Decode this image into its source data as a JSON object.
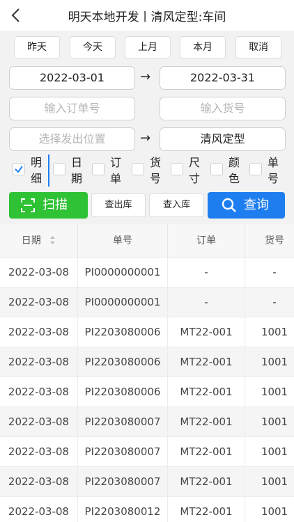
{
  "header": {
    "title": "明天本地开发丨清风定型:车间"
  },
  "quick_filters": [
    "昨天",
    "今天",
    "上月",
    "本月",
    "取消"
  ],
  "date_range": {
    "start": "2022-03-01",
    "arrow": "→",
    "end": "2022-03-31"
  },
  "inputs": {
    "order_placeholder": "输入订单号",
    "goods_placeholder": "输入货号"
  },
  "location": {
    "placeholder": "选择发出位置",
    "arrow": "→",
    "target": "清风定型"
  },
  "checkboxes": [
    {
      "label": "明细",
      "checked": true
    },
    {
      "label": "日期",
      "checked": false
    },
    {
      "label": "订单",
      "checked": false
    },
    {
      "label": "货号",
      "checked": false
    },
    {
      "label": "尺寸",
      "checked": false
    },
    {
      "label": "颜色",
      "checked": false
    },
    {
      "label": "单号",
      "checked": false
    }
  ],
  "actions": {
    "scan": "扫描",
    "outbound": "查出库",
    "inbound": "查入库",
    "query": "查询"
  },
  "colors": {
    "scan": "#2ec234",
    "query": "#1e7ef0",
    "accent_line": "#1e7ef0"
  },
  "table": {
    "columns": [
      "日期",
      "单号",
      "订单",
      "货号"
    ],
    "rows": [
      [
        "2022-03-08",
        "PI0000000001",
        "-",
        "-"
      ],
      [
        "2022-03-08",
        "PI0000000001",
        "-",
        "-"
      ],
      [
        "2022-03-08",
        "PI2203080006",
        "MT22-001",
        "1001"
      ],
      [
        "2022-03-08",
        "PI2203080006",
        "MT22-001",
        "1001"
      ],
      [
        "2022-03-08",
        "PI2203080006",
        "MT22-001",
        "1001"
      ],
      [
        "2022-03-08",
        "PI2203080007",
        "MT22-001",
        "1001"
      ],
      [
        "2022-03-08",
        "PI2203080007",
        "MT22-001",
        "1001"
      ],
      [
        "2022-03-08",
        "PI2203080007",
        "MT22-001",
        "1001"
      ],
      [
        "2022-03-08",
        "PI2203080012",
        "MT22-001",
        "1001"
      ]
    ]
  }
}
